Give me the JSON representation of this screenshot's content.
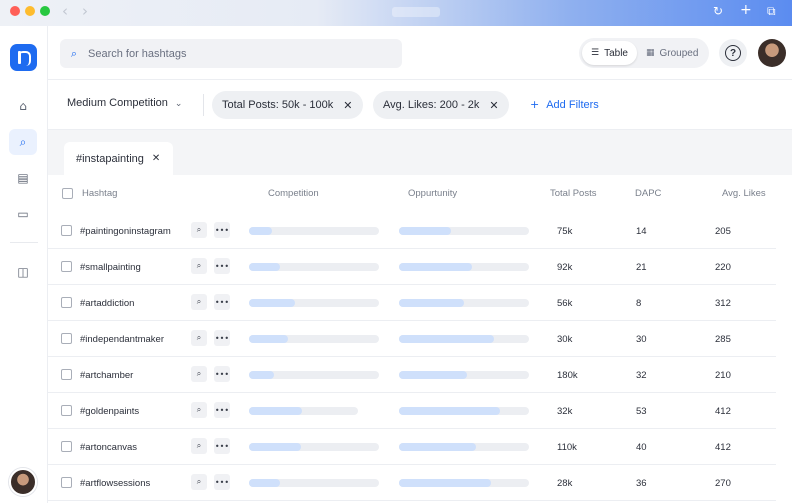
{
  "search": {
    "placeholder": "Search for hashtags"
  },
  "view_toggle": {
    "table_label": "Table",
    "grouped_label": "Grouped"
  },
  "help_label": "?",
  "filters": {
    "competition_label": "Medium Competition",
    "chips": [
      "Total Posts: 50k - 100k",
      "Avg. Likes: 200 - 2k"
    ],
    "add_label": "Add Filters"
  },
  "tab": {
    "label": "#instapainting"
  },
  "table": {
    "columns": {
      "hashtag": "Hashtag",
      "competition": "Competition",
      "opportunity": "Oppurtunity",
      "total_posts": "Total Posts",
      "dapc": "DAPC",
      "avg_likes": "Avg. Likes"
    },
    "rows": [
      {
        "hashtag": "#paintingoninstagram",
        "competition": 0.18,
        "opportunity": 0.4,
        "total_posts": "75k",
        "dapc": "14",
        "avg_likes": "205"
      },
      {
        "hashtag": "#smallpainting",
        "competition": 0.24,
        "opportunity": 0.56,
        "total_posts": "92k",
        "dapc": "21",
        "avg_likes": "220"
      },
      {
        "hashtag": "#artaddiction",
        "competition": 0.35,
        "opportunity": 0.5,
        "total_posts": "56k",
        "dapc": "8",
        "avg_likes": "312"
      },
      {
        "hashtag": "#independantmaker",
        "competition": 0.3,
        "opportunity": 0.73,
        "total_posts": "30k",
        "dapc": "30",
        "avg_likes": "285"
      },
      {
        "hashtag": "#artchamber",
        "competition": 0.19,
        "opportunity": 0.52,
        "total_posts": "180k",
        "dapc": "32",
        "avg_likes": "210"
      },
      {
        "hashtag": "#goldenpaints",
        "competition": 0.41,
        "opportunity": 0.78,
        "total_posts": "32k",
        "dapc": "53",
        "avg_likes": "412"
      },
      {
        "hashtag": "#artoncanvas",
        "competition": 0.4,
        "opportunity": 0.59,
        "total_posts": "110k",
        "dapc": "40",
        "avg_likes": "412"
      },
      {
        "hashtag": "#artflowsessions",
        "competition": 0.24,
        "opportunity": 0.71,
        "total_posts": "28k",
        "dapc": "36",
        "avg_likes": "270"
      }
    ]
  },
  "colors": {
    "accent": "#1e6bf0",
    "bar_fill": "#cfe0fb",
    "bar_track": "#eceef2"
  },
  "icons": [
    "home-icon",
    "search-icon",
    "analytics-icon",
    "folder-icon",
    "library-icon",
    "table-icon",
    "grid-icon",
    "help-icon",
    "close-icon",
    "plus-icon",
    "chevron-down-icon",
    "more-icon"
  ]
}
